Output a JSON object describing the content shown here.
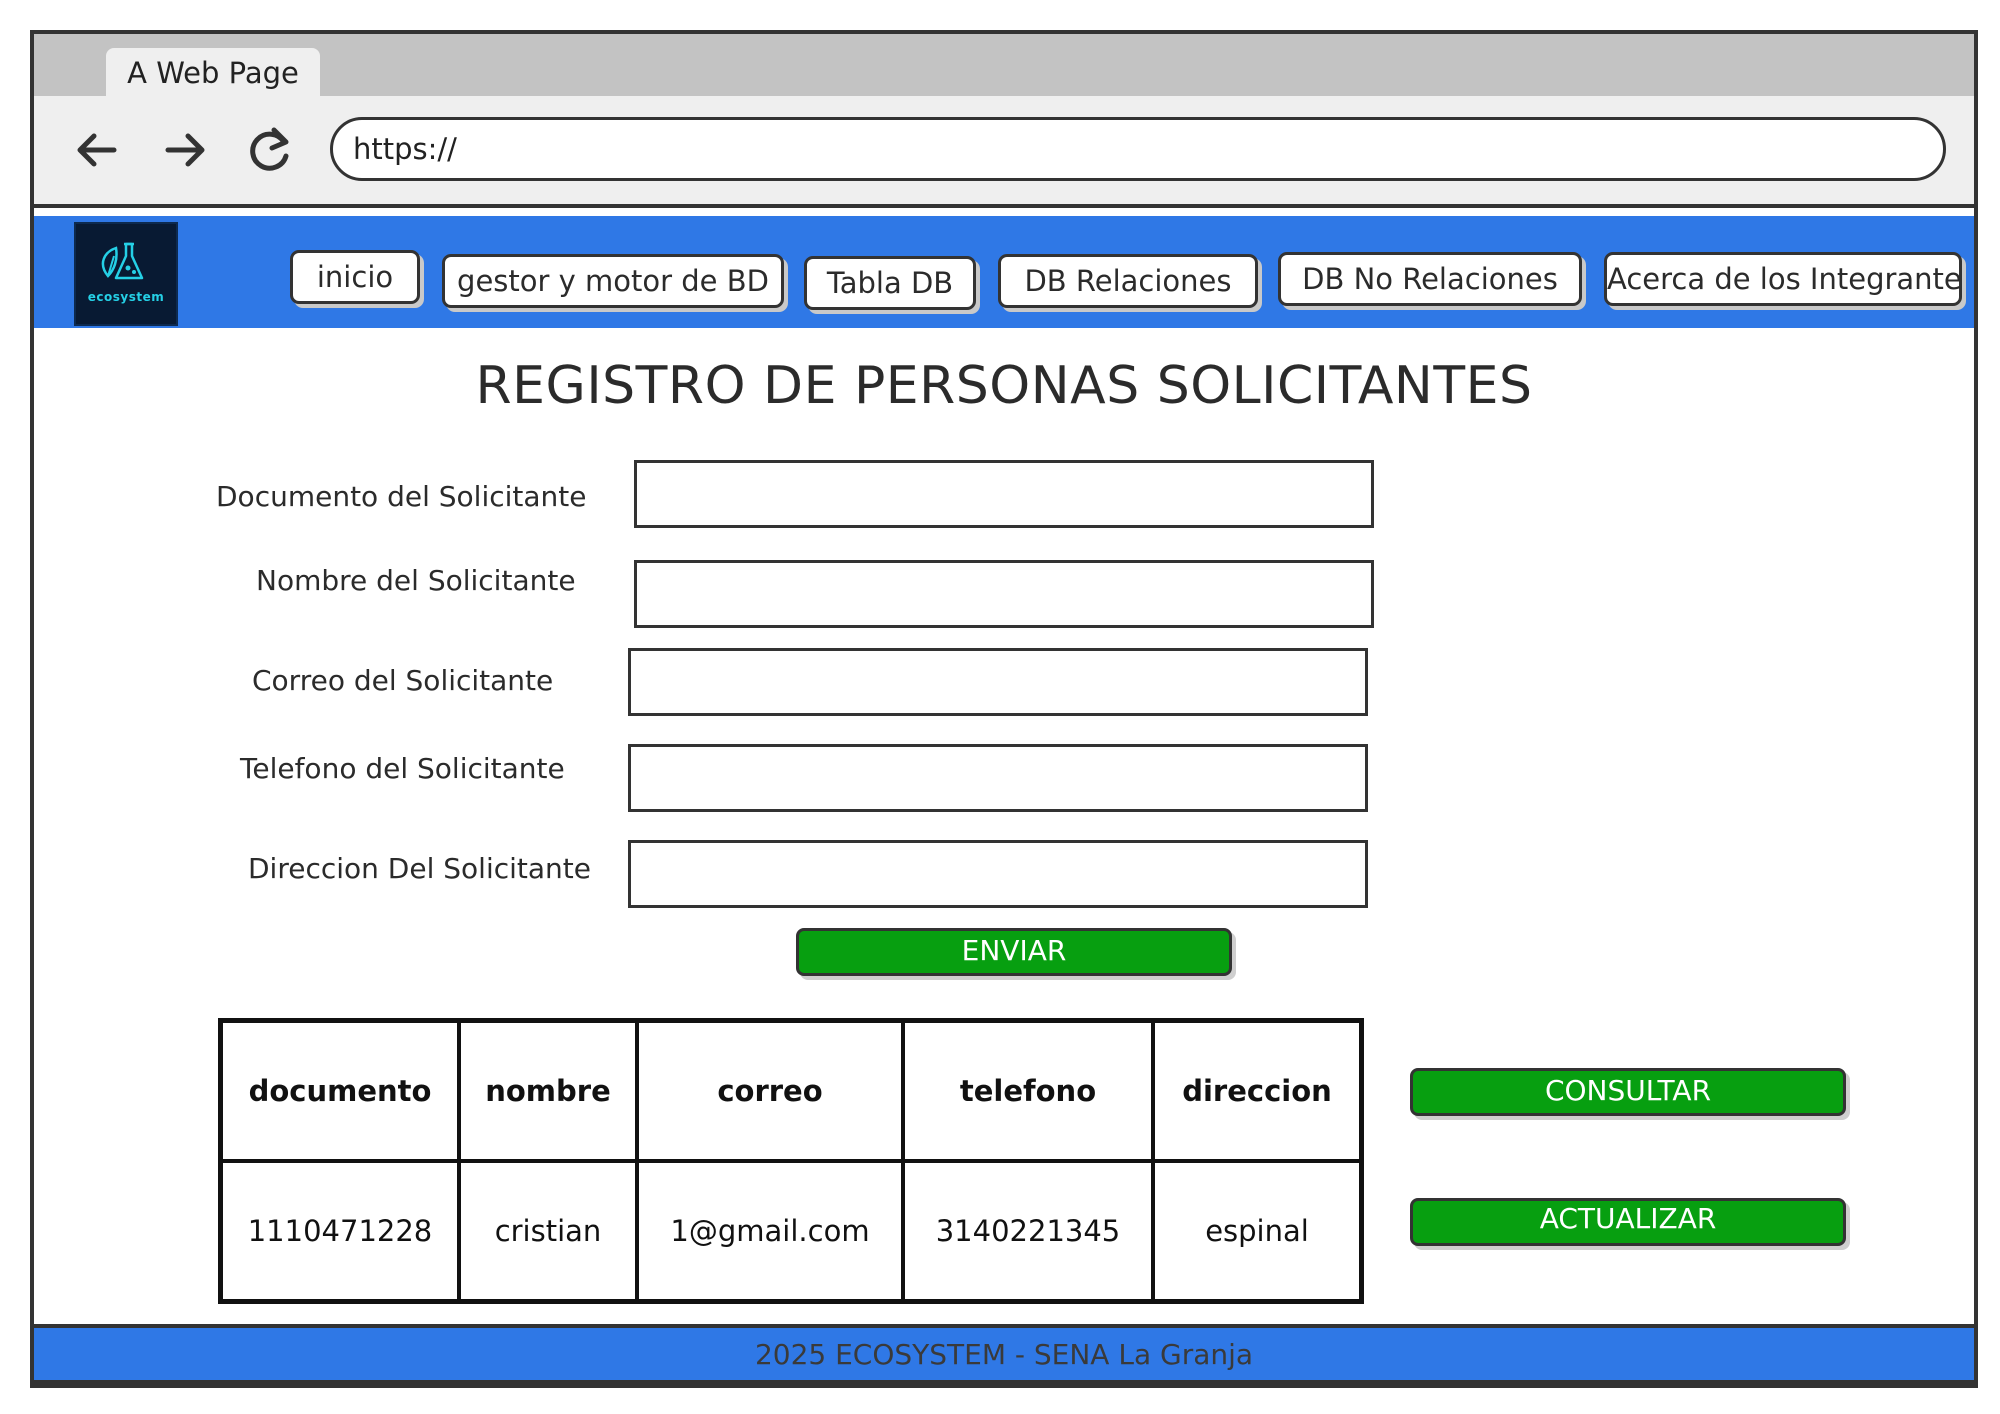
{
  "browser": {
    "tab_title": "A Web Page",
    "url": "https://",
    "icons": [
      "back-arrow-icon",
      "forward-arrow-icon",
      "reload-icon"
    ]
  },
  "header": {
    "logo_text": "ecosystem",
    "nav": [
      "inicio",
      "gestor y motor de BD",
      "Tabla DB",
      "DB Relaciones",
      "DB No Relaciones",
      "Acerca de los Integrante"
    ],
    "color": "#2f78e6"
  },
  "page": {
    "title": "REGISTRO DE PERSONAS SOLICITANTES"
  },
  "form": {
    "fields": [
      {
        "label": "Documento del Solicitante",
        "value": ""
      },
      {
        "label": "Nombre del Solicitante",
        "value": ""
      },
      {
        "label": "Correo del Solicitante",
        "value": ""
      },
      {
        "label": "Telefono del Solicitante",
        "value": ""
      },
      {
        "label": "Direccion Del Solicitante",
        "value": ""
      }
    ],
    "submit_label": "ENVIAR"
  },
  "table": {
    "headers": [
      "documento",
      "nombre",
      "correo",
      "telefono",
      "direccion"
    ],
    "rows": [
      [
        "1110471228",
        "cristian",
        "1@gmail.com",
        "3140221345",
        "espinal"
      ]
    ]
  },
  "actions": {
    "consult_label": "CONSULTAR",
    "update_label": "ACTUALIZAR",
    "color": "#079f10"
  },
  "footer": {
    "text": "2025 ECOSYSTEM - SENA La Granja"
  }
}
